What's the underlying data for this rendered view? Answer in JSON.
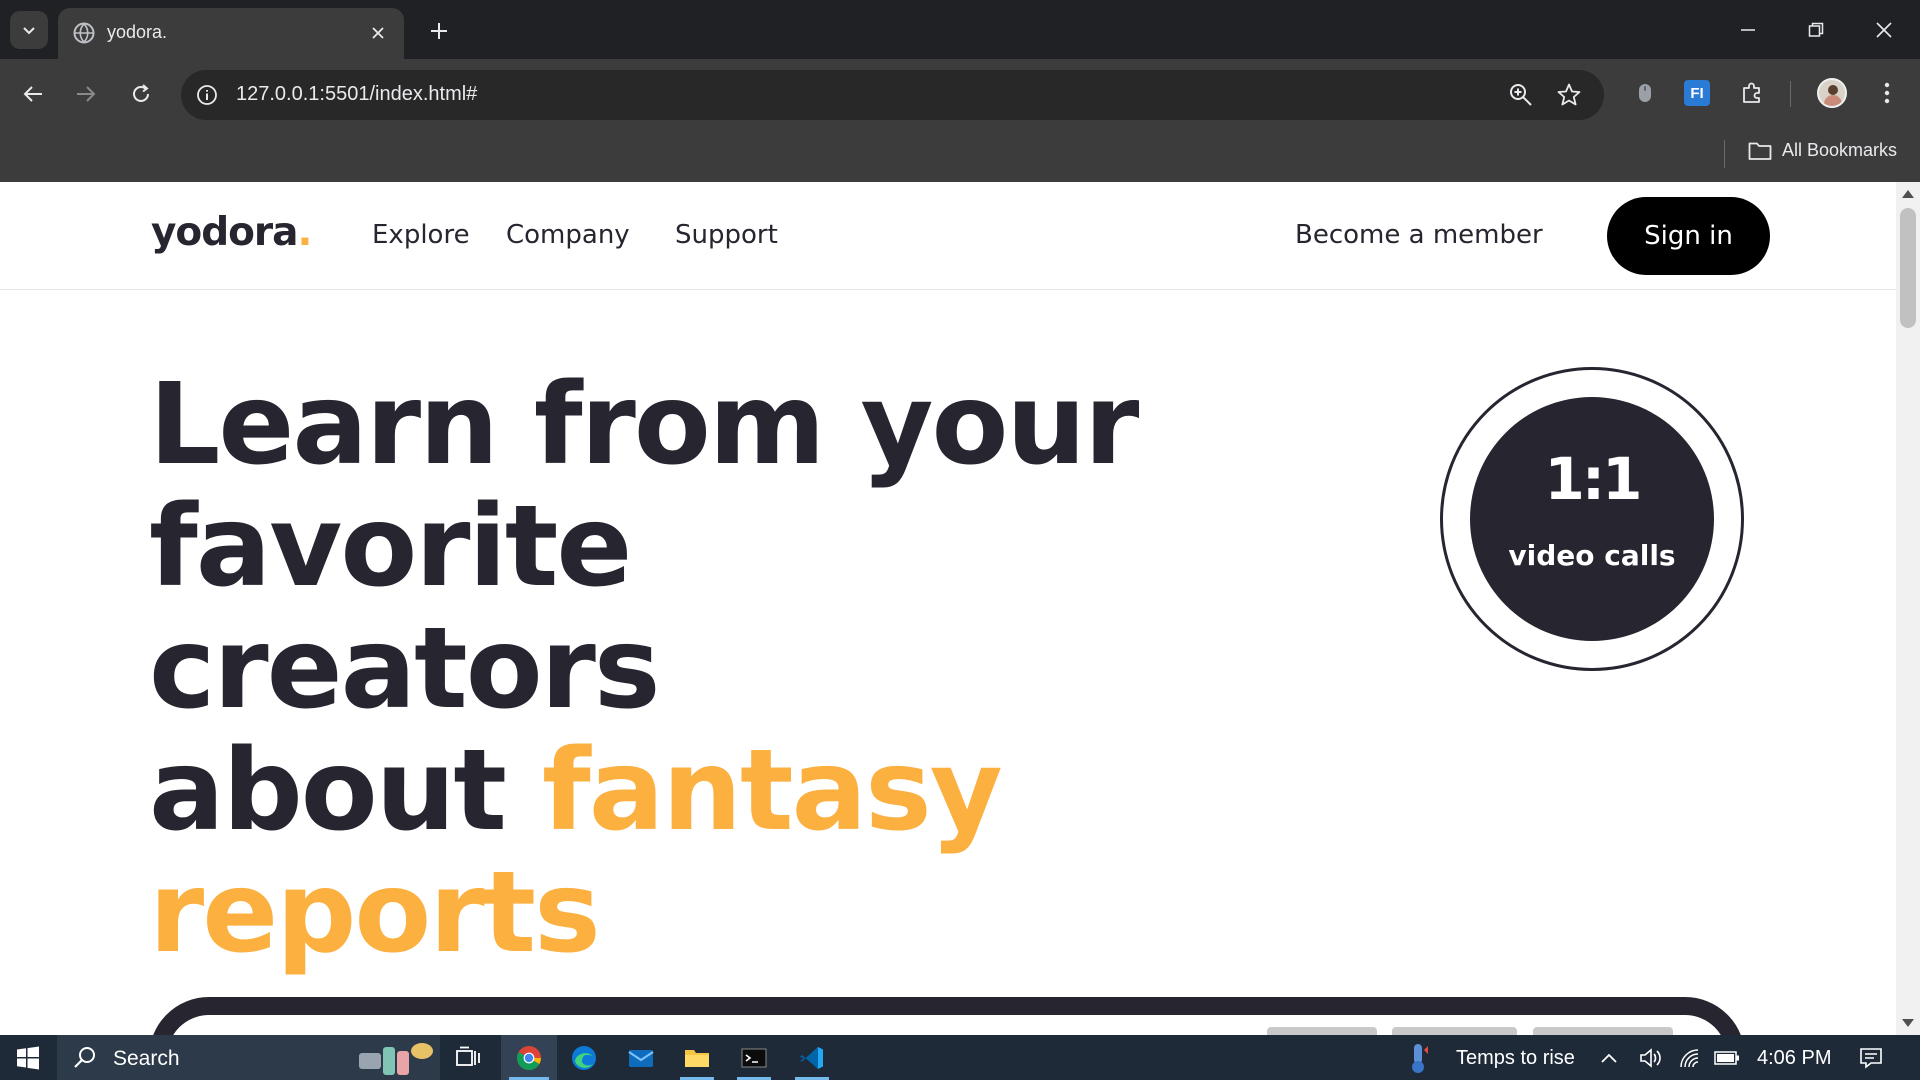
{
  "browser": {
    "tab_title": "yodora.",
    "url": "127.0.0.1:5501/index.html#",
    "bookmarks_label": "All Bookmarks",
    "extension_label": "FI"
  },
  "site": {
    "logo_text": "yodora",
    "logo_dot": ".",
    "nav": [
      "Explore",
      "Company",
      "Support"
    ],
    "member_link": "Become a member",
    "signin_label": "Sign in",
    "accent_color": "#fbb040",
    "dark_color": "#27252f"
  },
  "hero": {
    "line1": "Learn from your",
    "line2": "favorite creators",
    "line3_plain": "about ",
    "line3_accent": "fantasy",
    "line4_accent": "reports"
  },
  "badge": {
    "big": "1:1",
    "small": "video calls"
  },
  "taskbar": {
    "search_label": "Search",
    "weather_label": "Temps to rise",
    "time": "4:06 PM"
  }
}
